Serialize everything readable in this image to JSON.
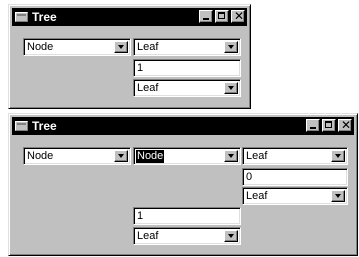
{
  "window1": {
    "title": "Tree",
    "combo_node": "Node",
    "combo_leaf": "Leaf",
    "field_value": "1",
    "combo_leaf2": "Leaf"
  },
  "window2": {
    "title": "Tree",
    "combo_node": "Node",
    "combo_node_selected": "Node",
    "combo_leaf": "Leaf",
    "field_value0": "0",
    "combo_leaf2": "Leaf",
    "field_value1": "1",
    "combo_leaf3": "Leaf"
  },
  "colors": {
    "titlebar": "#000000",
    "face": "#c0c0c0",
    "selection": "#000000"
  }
}
